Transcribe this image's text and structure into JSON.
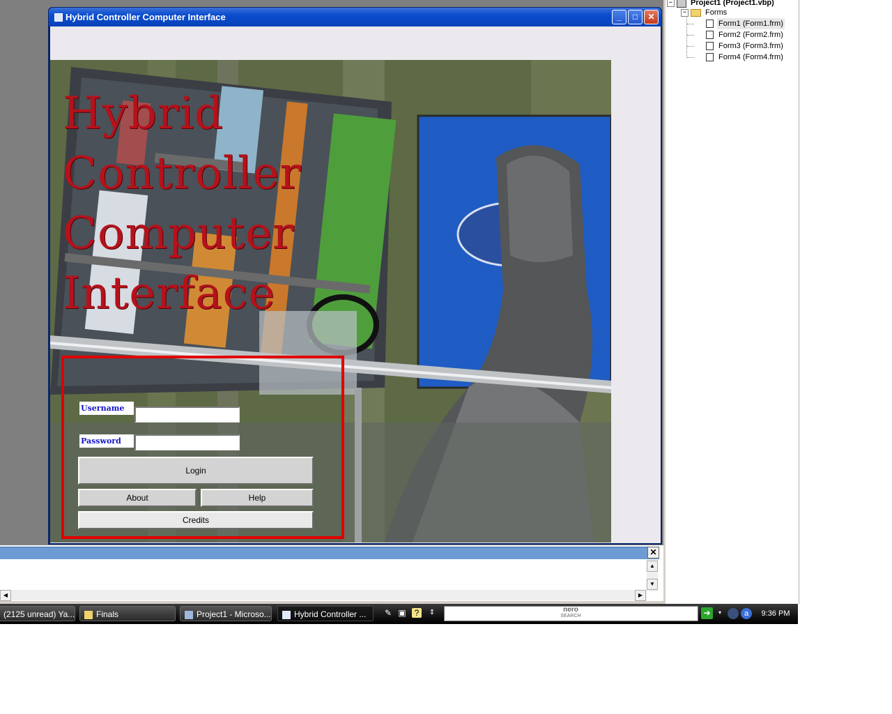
{
  "app_window": {
    "title": "Hybrid Controller Computer Interface",
    "hero_title_lines": [
      "Hybrid",
      "Controller",
      "Computer",
      "Interface"
    ],
    "login": {
      "username_label": "Username",
      "password_label": "Password",
      "username_value": "",
      "password_value": "",
      "login_button": "Login",
      "about_button": "About",
      "help_button": "Help",
      "credits_button": "Credits"
    },
    "window_controls": {
      "minimize": "_",
      "maximize": "□",
      "close": "✕"
    }
  },
  "project_explorer": {
    "project": "Project1 (Project1.vbp)",
    "folder": "Forms",
    "forms": [
      "Form1 (Form1.frm)",
      "Form2 (Form2.frm)",
      "Form3 (Form3.frm)",
      "Form4 (Form4.frm)"
    ],
    "selected_index": 0
  },
  "immediate_window": {
    "close": "✕"
  },
  "taskbar": {
    "tasks": [
      "(2125 unread) Ya...",
      "Finals",
      "Project1 - Microso...",
      "Hybrid Controller ..."
    ],
    "active_task_index": 3,
    "search_brand": "nero",
    "search_brand_sub": "SEARCH",
    "clock": "9:36 PM"
  },
  "colors": {
    "accent_red": "#b5121b",
    "frame_red": "#e00000",
    "label_blue": "#1414c8",
    "titlebar_blue": "#0a4ccf"
  }
}
